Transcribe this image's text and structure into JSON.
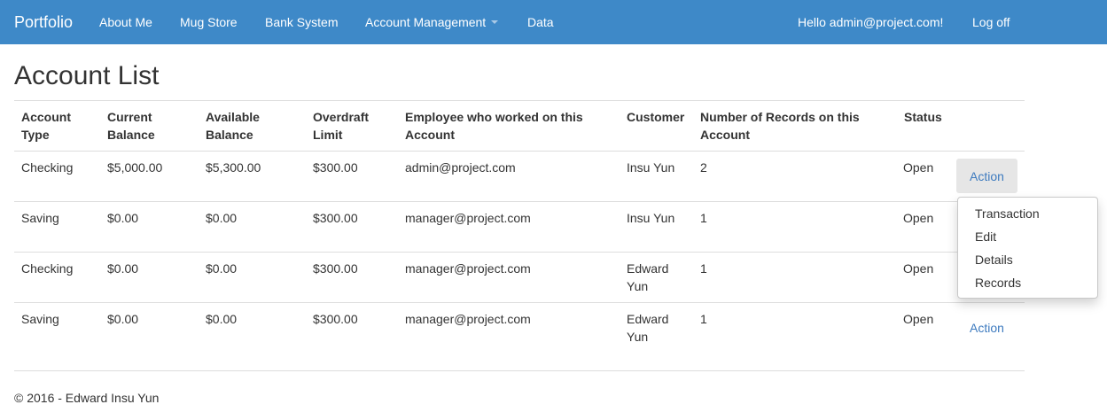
{
  "nav": {
    "brand": "Portfolio",
    "links": [
      "About Me",
      "Mug Store",
      "Bank System",
      "Account Management",
      "Data"
    ],
    "greeting": "Hello admin@project.com!",
    "logoff": "Log off"
  },
  "page": {
    "title": "Account List"
  },
  "table": {
    "headers": [
      [
        "Account",
        "Type"
      ],
      [
        "Current",
        "Balance"
      ],
      [
        "Available",
        "Balance"
      ],
      [
        "Overdraft",
        "Limit"
      ],
      [
        "Employee who worked on this",
        "Account"
      ],
      [
        "Customer",
        ""
      ],
      [
        "Number of Records on this",
        "Account"
      ],
      [
        "Status",
        ""
      ]
    ],
    "rows": [
      {
        "type": "Checking",
        "current": "$5,000.00",
        "available": "$5,300.00",
        "overdraft": "$300.00",
        "employee": "admin@project.com",
        "customer": [
          "Insu Yun",
          ""
        ],
        "records": "2",
        "status": "Open",
        "action": "Action"
      },
      {
        "type": "Saving",
        "current": "$0.00",
        "available": "$0.00",
        "overdraft": "$300.00",
        "employee": "manager@project.com",
        "customer": [
          "Insu Yun",
          ""
        ],
        "records": "1",
        "status": "Open",
        "action": ""
      },
      {
        "type": "Checking",
        "current": "$0.00",
        "available": "$0.00",
        "overdraft": "$300.00",
        "employee": "manager@project.com",
        "customer": [
          "Edward",
          "Yun"
        ],
        "records": "1",
        "status": "Open",
        "action": ""
      },
      {
        "type": "Saving",
        "current": "$0.00",
        "available": "$0.00",
        "overdraft": "$300.00",
        "employee": "manager@project.com",
        "customer": [
          "Edward",
          "Yun"
        ],
        "records": "1",
        "status": "Open",
        "action": "Action"
      }
    ]
  },
  "dropdown": {
    "items": [
      "Transaction",
      "Edit",
      "Details",
      "Records"
    ]
  },
  "footer": {
    "text": "© 2016 - Edward Insu Yun"
  },
  "colors": {
    "navbar": "#3e89c8",
    "link": "#3e7bbf",
    "active_button": "#e6e6e6"
  }
}
